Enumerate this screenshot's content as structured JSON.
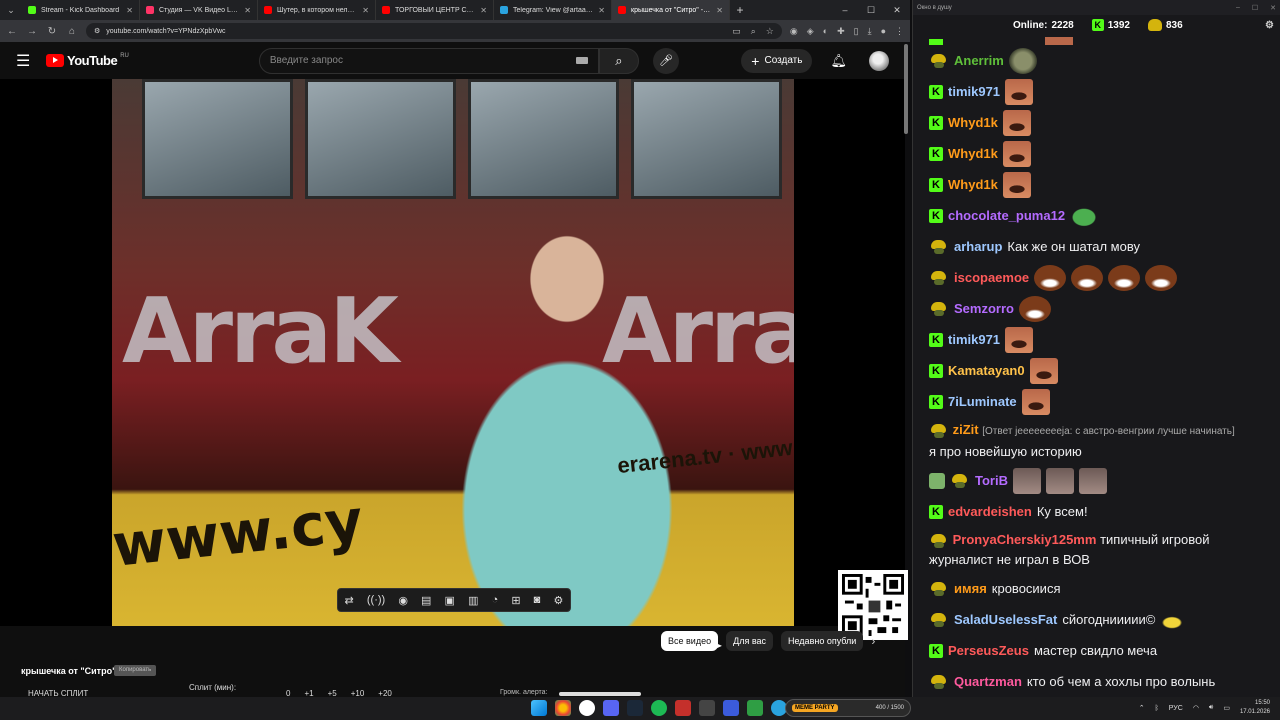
{
  "browser": {
    "tabs": [
      {
        "title": "Stream - Kick Dashboard",
        "color": "#53fc18"
      },
      {
        "title": "Студия — VK Видео Live",
        "color": "#ff3366"
      },
      {
        "title": "Шутер, в котором нельзя стр...",
        "color": "#ff0000"
      },
      {
        "title": "ТОРГОВЫЙ ЦЕНТР СМЕРТИ -",
        "color": "#ff0000"
      },
      {
        "title": "Telegram: View @artaamonova",
        "color": "#2aa3df"
      },
      {
        "title": "крышечка от \"Ситро\" - Yo",
        "color": "#ff0000"
      }
    ],
    "url": "youtube.com/watch?v=YPNdzXpbVwc"
  },
  "youtube": {
    "logo_text": "YouTube",
    "region": "RU",
    "search_placeholder": "Введите запрос",
    "create_label": "Создать",
    "video": {
      "sign_text": "ArraK",
      "banner_text": "www.cy",
      "banner_text2": "erarena.tv · www"
    },
    "stream_title": "крышечка от \"Ситро\"",
    "stream_badge": "Копировать",
    "start_split": "НАЧАТЬ СПЛИТ",
    "split_label": "Сплит (мин):",
    "split_values": [
      "0",
      "+1",
      "+5",
      "+10",
      "+20"
    ],
    "volume_label": "Громк. алерта:",
    "volume_level": 1.0,
    "chips": [
      "Все видео",
      "Для вас",
      "Недавно опубли"
    ],
    "toolbar_icons": [
      "repeat-icon",
      "broadcast-icon",
      "eye-icon",
      "clapperboard-icon",
      "aspect-icon",
      "subtitles-icon",
      "speedometer-icon",
      "plus-box-icon",
      "camera-icon",
      "gear-icon"
    ]
  },
  "chat": {
    "window_title": "Окно в душу",
    "online_label": "Online:",
    "online_count": "2228",
    "kick_count": "1392",
    "coins_count": "836",
    "messages": [
      {
        "badge": "peepo",
        "user": "Anerrim",
        "color": "#5fbf3a",
        "text": "",
        "emotes": [
          "alien"
        ]
      },
      {
        "badge": "kick",
        "user": "timik971",
        "color": "#9ec8ff",
        "text": "",
        "emotes": [
          "face"
        ]
      },
      {
        "badge": "kick",
        "user": "Whyd1k",
        "color": "#ff9b1a",
        "text": "",
        "emotes": [
          "face"
        ]
      },
      {
        "badge": "kick",
        "user": "Whyd1k",
        "color": "#ff9b1a",
        "text": "",
        "emotes": [
          "face"
        ]
      },
      {
        "badge": "kick",
        "user": "Whyd1k",
        "color": "#ff9b1a",
        "text": "",
        "emotes": [
          "face"
        ]
      },
      {
        "badge": "kick",
        "user": "chocolate_puma12",
        "color": "#b46bff",
        "text": "",
        "emotes": [
          "pepe"
        ]
      },
      {
        "badge": "peepo",
        "user": "arharup",
        "color": "#9ec8ff",
        "text": "Как же он шатал мову",
        "emotes": []
      },
      {
        "badge": "peepo",
        "user": "iscopaemoe",
        "color": "#ff5a5a",
        "text": "",
        "emotes": [
          "laugh",
          "laugh",
          "laugh",
          "laugh"
        ]
      },
      {
        "badge": "peepo",
        "user": "Semzorro",
        "color": "#b46bff",
        "text": "",
        "emotes": [
          "laugh"
        ]
      },
      {
        "badge": "kick",
        "user": "timik971",
        "color": "#9ec8ff",
        "text": "",
        "emotes": [
          "face"
        ]
      },
      {
        "badge": "kick",
        "user": "Kamatayan0",
        "color": "#ffc24a",
        "text": "",
        "emotes": [
          "face"
        ]
      },
      {
        "badge": "kick",
        "user": "7iLuminate",
        "color": "#9ec8ff",
        "text": "",
        "emotes": [
          "face"
        ]
      }
    ],
    "reply_message": {
      "user": "ziZit",
      "color": "#ff9b1a",
      "reply": "[Ответ jeeeeeeeeja: с австро-венгрии лучше начинать]",
      "text": "я про новейшую историю"
    },
    "messages2": [
      {
        "badge": "peepo",
        "user": "ToriB",
        "color": "#b46bff",
        "text": "",
        "emotes": [
          "grey",
          "grey",
          "grey"
        ]
      },
      {
        "badge": "kick",
        "user": "edvardeishen",
        "color": "#ff5a5a",
        "text": "Ку всем!",
        "emotes": []
      }
    ],
    "wrap_message": {
      "user": "PronyaCherskiy125mm",
      "color": "#ff5a5a",
      "text": "типичный игровой журналист не играл в ВОВ"
    },
    "messages3": [
      {
        "badge": "peepo",
        "user": "имяя",
        "color": "#ff9b1a",
        "text": "кровосиися",
        "emotes": []
      },
      {
        "badge": "peepo",
        "user": "SaladUselessFat",
        "color": "#9ec8ff",
        "text": "сйогодниииии©",
        "emotes": [
          "banana"
        ]
      },
      {
        "badge": "kick",
        "user": "PerseusZeus",
        "color": "#ff5a5a",
        "text": "мастер свидло меча",
        "emotes": []
      },
      {
        "badge": "peepo",
        "user": "Quartzman",
        "color": "#ff5a9e",
        "text": "кто об чем а хохлы про волынь",
        "emotes": []
      }
    ]
  },
  "taskbar": {
    "meme_badge": "MEME PARTY",
    "meme_count": "400 / 1500",
    "lang": "РУС",
    "time": "15:50",
    "date": "17.01.2026"
  }
}
